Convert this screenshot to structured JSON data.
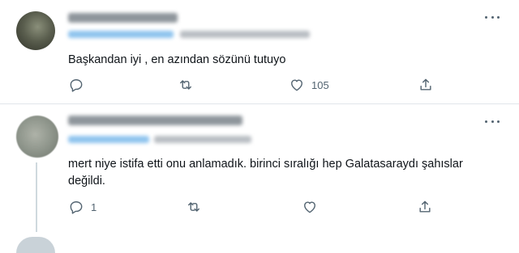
{
  "tweets": [
    {
      "text": "Başkandan iyi , en azından sözünü tutuyo",
      "reply_count": "",
      "retweet_count": "",
      "like_count": "105"
    },
    {
      "text": "mert niye istifa etti onu anlamadık. birinci sıralığı hep Galatasaraydı şahıslar\ndeğildi.",
      "reply_count": "1",
      "retweet_count": "",
      "like_count": ""
    }
  ],
  "icons": {
    "reply": "reply-icon",
    "retweet": "retweet-icon",
    "like": "heart-icon",
    "share": "share-icon",
    "more": "more-icon"
  }
}
